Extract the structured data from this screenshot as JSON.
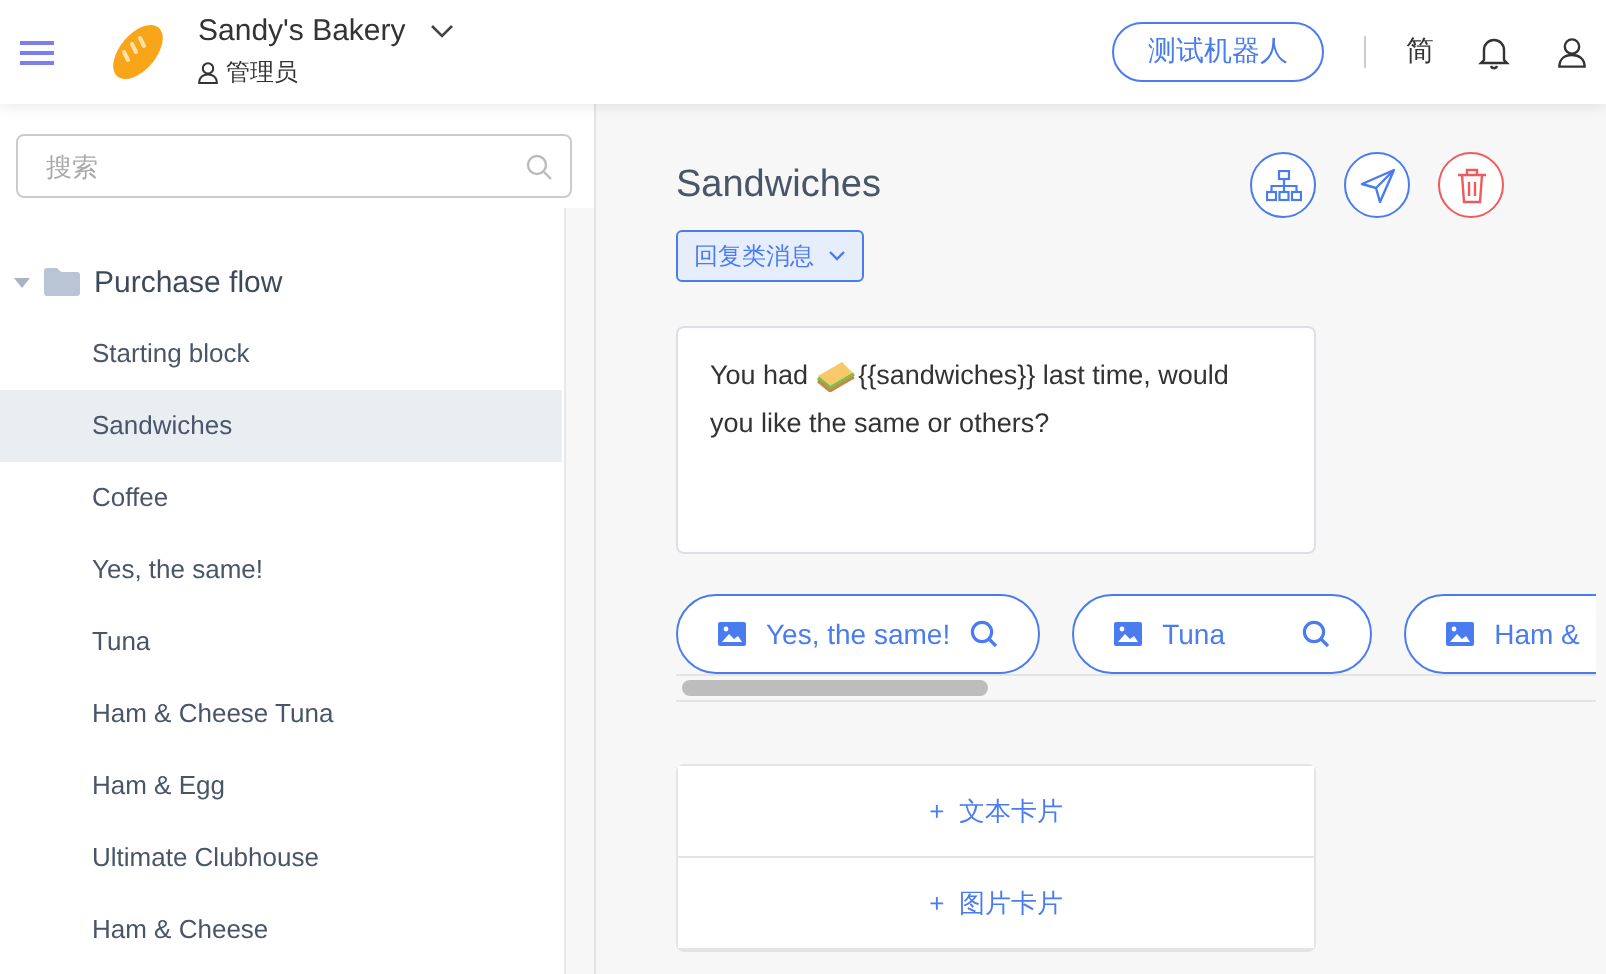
{
  "header": {
    "brand": "Sandy's Bakery",
    "role": "管理员",
    "test_button": "测试机器人",
    "language": "简"
  },
  "sidebar": {
    "search": {
      "placeholder": "搜索"
    },
    "tree": [
      {
        "label": "Purchase flow",
        "expanded": true,
        "children": [
          {
            "label": "Starting block",
            "selected": false
          },
          {
            "label": "Sandwiches",
            "selected": true
          },
          {
            "label": "Coffee",
            "selected": false
          },
          {
            "label": "Yes, the same!",
            "selected": false
          },
          {
            "label": "Tuna",
            "selected": false
          },
          {
            "label": "Ham & Cheese Tuna",
            "selected": false
          },
          {
            "label": "Ham & Egg",
            "selected": false
          },
          {
            "label": "Ultimate Clubhouse",
            "selected": false
          },
          {
            "label": "Ham & Cheese",
            "selected": false
          }
        ]
      }
    ]
  },
  "editor": {
    "title": "Sandwiches",
    "type_dropdown": "回复类消息",
    "message": {
      "before": "You had",
      "after": "{{sandwiches}} last time, would",
      "second_line": "you like the same or others?"
    },
    "quick_replies": [
      {
        "label": "Yes, the same!",
        "search_icon": true
      },
      {
        "label": "Tuna",
        "search_icon": true
      },
      {
        "label": "Ham &",
        "search_icon": false
      }
    ],
    "add_cards": [
      "+  文本卡片",
      "+  图片卡片"
    ]
  }
}
